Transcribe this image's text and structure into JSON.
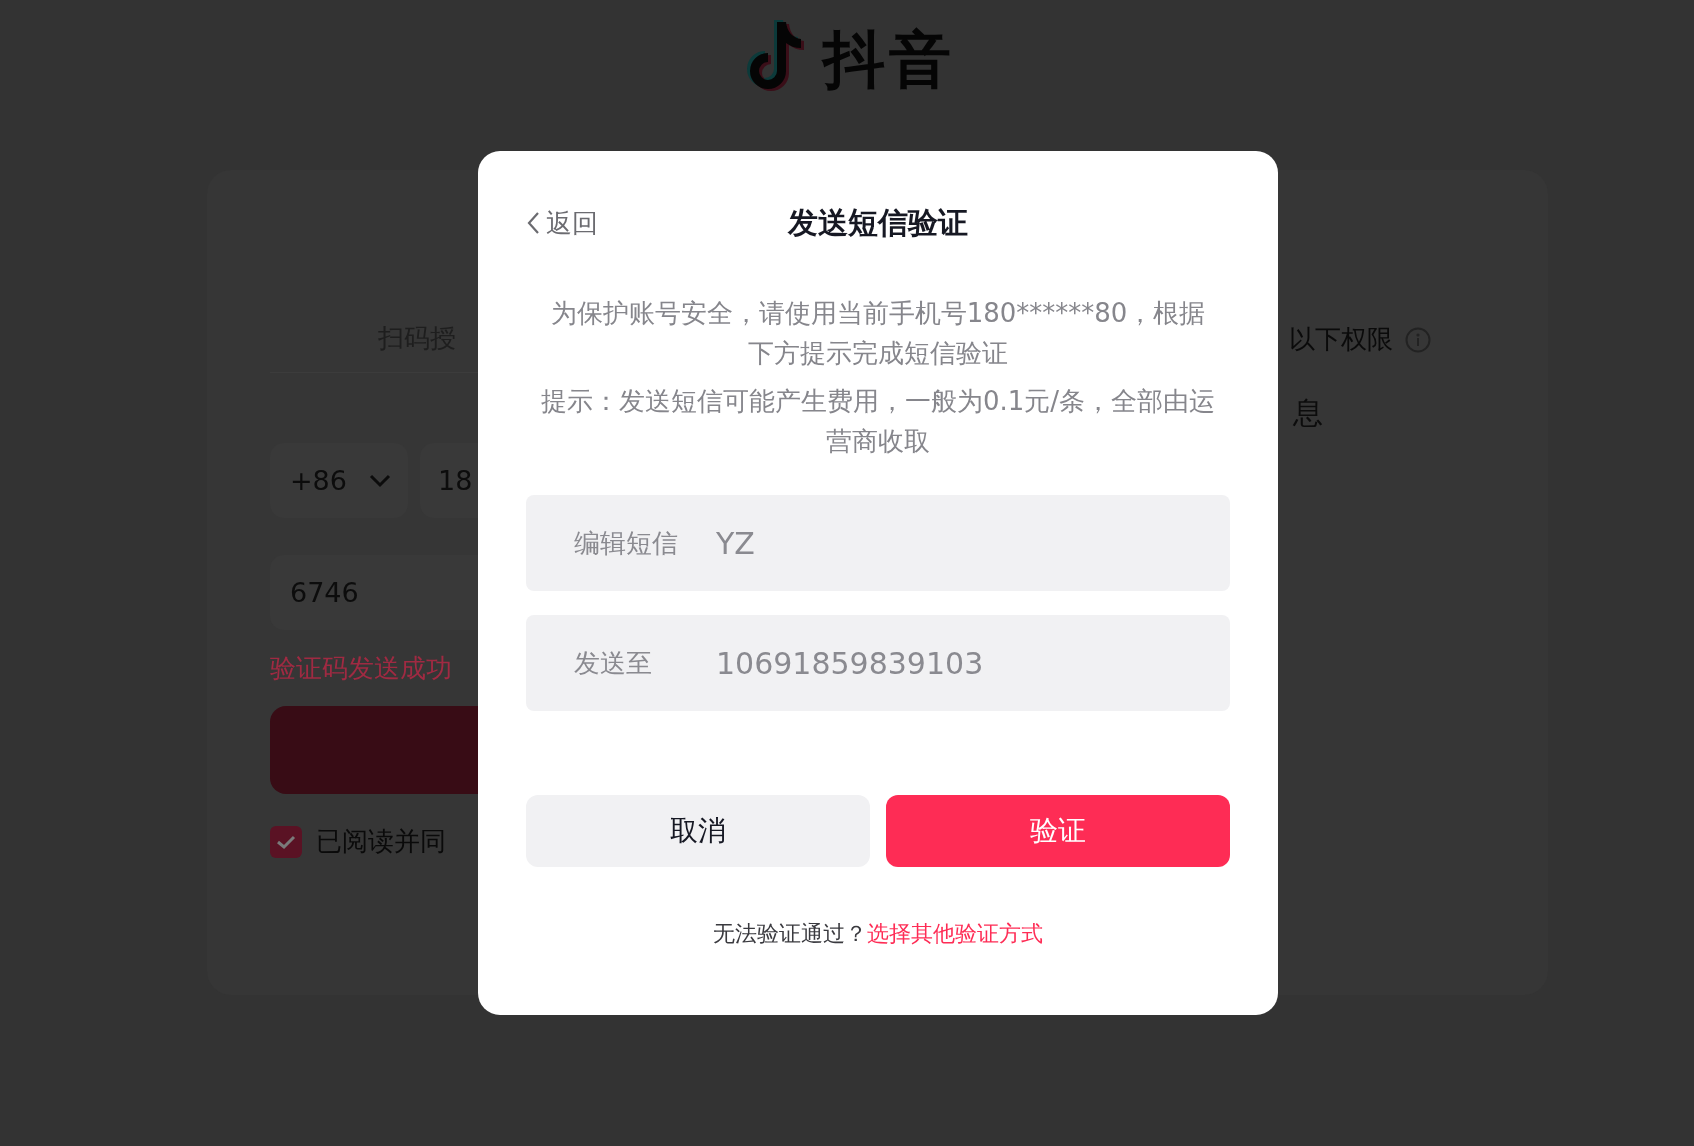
{
  "logo": {
    "text": "抖音"
  },
  "background": {
    "tab_text": "扫码授",
    "permission_text": "以下权限",
    "permission_item": "息",
    "country_code": "+86",
    "phone": "18",
    "code": "6746",
    "status": "验证码发送成功",
    "agree": {
      "checked": true,
      "label": "已阅读并同"
    }
  },
  "dialog": {
    "back": "返回",
    "title": "发送短信验证",
    "paragraphs": [
      "为保护账号安全，请使用当前手机号180******80，根据下方提示完成短信验证",
      "提示：发送短信可能产生费用，一般为0.1元/条，全部由运营商收取"
    ],
    "fields": [
      {
        "label": "编辑短信",
        "value": "YZ"
      },
      {
        "label": "发送至",
        "value": "10691859839103"
      }
    ],
    "buttons": [
      {
        "label": "取消",
        "kind": "secondary"
      },
      {
        "label": "验证",
        "kind": "primary"
      }
    ],
    "footer": {
      "text": "无法验证通过？",
      "link": "选择其他验证方式"
    }
  }
}
